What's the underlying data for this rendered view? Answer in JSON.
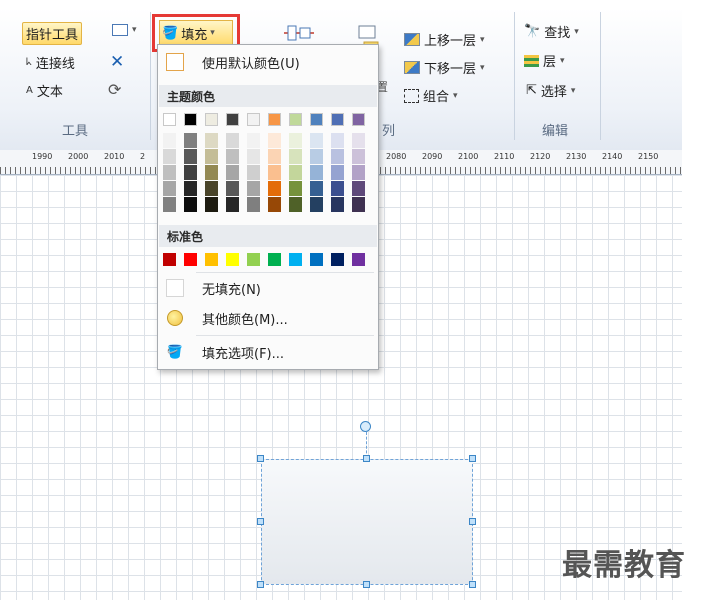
{
  "ribbon": {
    "tools_group": {
      "pointer_tool": "指针工具",
      "connector": "连接线",
      "text": "文本",
      "group_label": "工具"
    },
    "fill_button": "填充",
    "arrange_group": {
      "bring_forward": "上移一层",
      "send_backward": "下移一层",
      "group": "组合",
      "group_label_partial": "列"
    },
    "edit_group": {
      "find": "查找",
      "layers": "层",
      "select": "选择",
      "group_label": "编辑"
    }
  },
  "ruler": {
    "labels": [
      "1990",
      "2000",
      "2010",
      "2",
      "2080",
      "2090",
      "2100",
      "2110",
      "2120",
      "2130",
      "2140",
      "2150"
    ]
  },
  "fill_menu": {
    "use_default": "使用默认颜色(U)",
    "theme_colors_header": "主题颜色",
    "standard_colors_header": "标准色",
    "no_fill": "无填充(N)",
    "more_colors": "其他颜色(M)...",
    "fill_options": "填充选项(F)...",
    "theme_top_row": [
      "#ffffff",
      "#000000",
      "#eeece1",
      "#404040",
      "#f2f2f2",
      "#f79646",
      "#c0d99a",
      "#4f81bd",
      "#4f6fb5",
      "#8064a2"
    ],
    "theme_shade_columns": [
      [
        "#f2f2f2",
        "#d9d9d9",
        "#bfbfbf",
        "#a6a6a6",
        "#808080"
      ],
      [
        "#7f7f7f",
        "#595959",
        "#404040",
        "#262626",
        "#0d0d0d"
      ],
      [
        "#ddd9c3",
        "#c4bd97",
        "#938953",
        "#494429",
        "#1d1b10"
      ],
      [
        "#d9d9d9",
        "#bfbfbf",
        "#a6a6a6",
        "#595959",
        "#262626"
      ],
      [
        "#f2f2f2",
        "#e6e6e6",
        "#cfcfcf",
        "#a6a6a6",
        "#7f7f7f"
      ],
      [
        "#fde9d9",
        "#fbd4b4",
        "#fabf8f",
        "#e36c09",
        "#974806"
      ],
      [
        "#ebf1dd",
        "#d7e3bc",
        "#c3d69b",
        "#76923c",
        "#4f6128"
      ],
      [
        "#dbe5f1",
        "#b8cce4",
        "#95b3d7",
        "#366092",
        "#244061"
      ],
      [
        "#dce0f0",
        "#b9c1e0",
        "#95a3d1",
        "#3c4f8f",
        "#28355f"
      ],
      [
        "#e5e0ec",
        "#ccc1d9",
        "#b2a2c7",
        "#5f497a",
        "#3f3151"
      ]
    ],
    "standard_colors": [
      "#c00000",
      "#ff0000",
      "#ffc000",
      "#ffff00",
      "#92d050",
      "#00b050",
      "#00b0f0",
      "#0070c0",
      "#002060",
      "#7030a0"
    ]
  },
  "watermark": "最需教育"
}
